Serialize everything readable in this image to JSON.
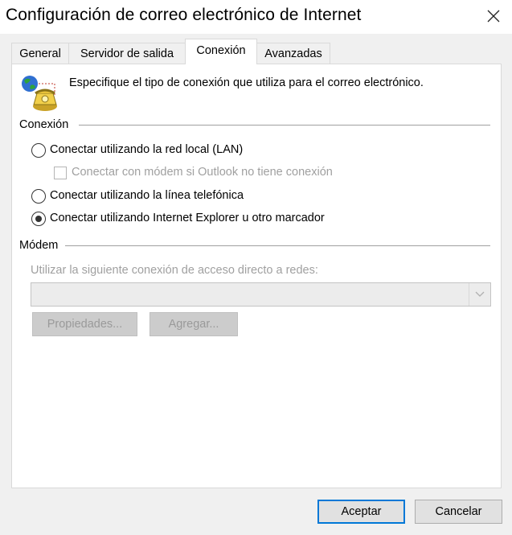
{
  "window": {
    "title": "Configuración de correo electrónico de Internet"
  },
  "icons": {
    "close": "close-icon",
    "connection": "globe-telephone-icon",
    "dropdown": "chevron-down-icon"
  },
  "tabs": [
    {
      "label": "General",
      "active": false
    },
    {
      "label": "Servidor de salida",
      "active": false
    },
    {
      "label": "Conexión",
      "active": true
    },
    {
      "label": "Avanzadas",
      "active": false
    }
  ],
  "panel": {
    "description": "Especifique el tipo de conexión que utiliza para el correo electrónico.",
    "connection_group": {
      "label": "Conexión",
      "options": [
        {
          "label": "Conectar utilizando la red local (LAN)",
          "selected": false
        },
        {
          "label": "Conectar utilizando la línea telefónica",
          "selected": false
        },
        {
          "label": "Conectar utilizando Internet Explorer u otro marcador",
          "selected": true
        }
      ],
      "modem_checkbox": {
        "label": "Conectar con módem si Outlook no tiene conexión",
        "checked": false,
        "enabled": false
      }
    },
    "modem_group": {
      "label": "Módem",
      "dialup_label": "Utilizar la siguiente conexión de acceso directo a redes:",
      "dialup_value": "",
      "properties_button": "Propiedades...",
      "add_button": "Agregar..."
    }
  },
  "footer": {
    "ok_label": "Aceptar",
    "cancel_label": "Cancelar"
  },
  "colors": {
    "accent": "#0078d7",
    "window_bg": "#f0f0f0",
    "panel_bg": "#ffffff",
    "disabled_text": "#a0a0a0"
  }
}
